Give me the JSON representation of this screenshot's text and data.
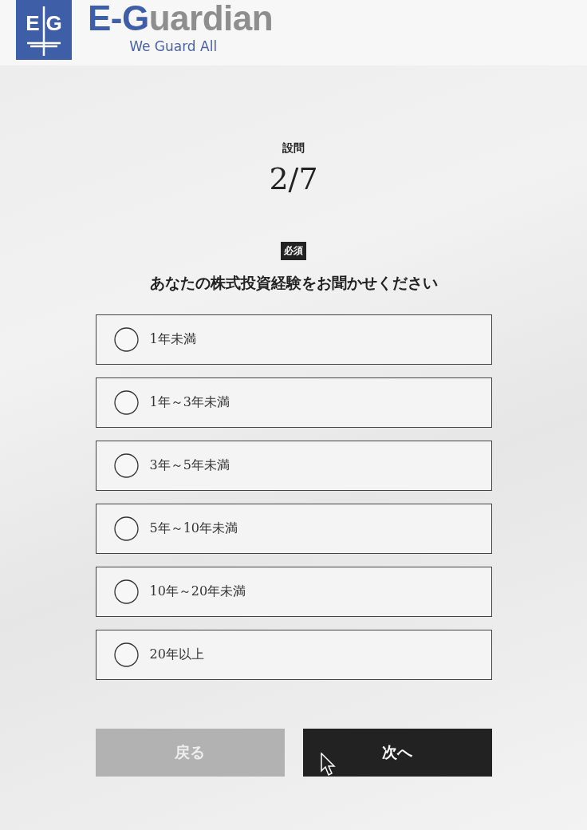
{
  "header": {
    "logo_mark": [
      "E",
      "G"
    ],
    "logo_name": [
      "E-G",
      "uardian"
    ],
    "tagline": "We Guard All"
  },
  "question": {
    "label": "設問",
    "progress": "2/7",
    "badge": "必須",
    "text": "あなたの株式投資経験をお聞かせください"
  },
  "options": [
    {
      "label": "1年未満",
      "selected": false
    },
    {
      "label": "1年～3年未満",
      "selected": false
    },
    {
      "label": "3年～5年未満",
      "selected": false
    },
    {
      "label": "5年～10年未満",
      "selected": false
    },
    {
      "label": "10年～20年未満",
      "selected": false
    },
    {
      "label": "20年以上",
      "selected": false
    }
  ],
  "buttons": [
    {
      "label": "戻る",
      "kind": "back",
      "disabled": true
    },
    {
      "label": "次へ",
      "kind": "next",
      "disabled": false
    }
  ]
}
